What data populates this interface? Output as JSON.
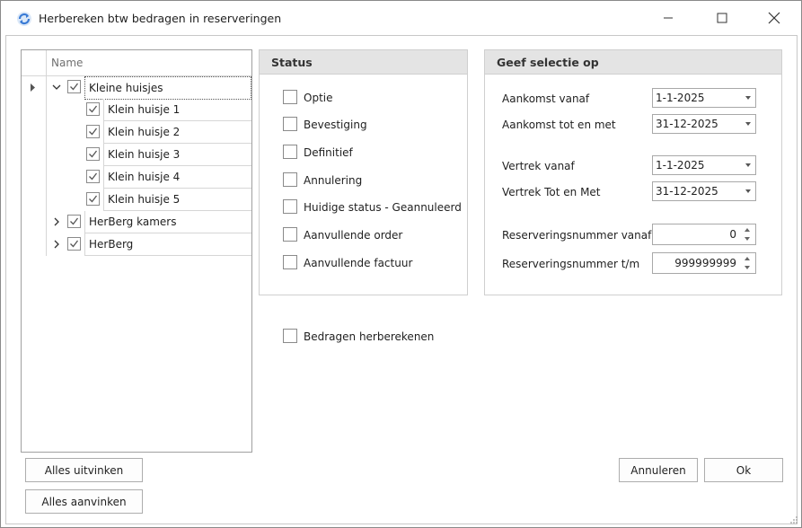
{
  "window": {
    "title": "Herbereken btw bedragen in reserveringen"
  },
  "tree": {
    "header": "Name",
    "rows": [
      {
        "label": "Kleine huisjes",
        "checked": true,
        "expanded": true
      },
      {
        "label": "Klein huisje 1",
        "checked": true
      },
      {
        "label": "Klein huisje 2",
        "checked": true
      },
      {
        "label": "Klein huisje 3",
        "checked": true
      },
      {
        "label": "Klein huisje 4",
        "checked": true
      },
      {
        "label": "Klein huisje 5",
        "checked": true
      },
      {
        "label": "HerBerg kamers",
        "checked": true,
        "expanded": false
      },
      {
        "label": "HerBerg",
        "checked": true,
        "expanded": false
      }
    ]
  },
  "status": {
    "title": "Status",
    "options": [
      "Optie",
      "Bevestiging",
      "Definitief",
      "Annulering",
      "Huidige status - Geannuleerd",
      "Aanvullende order",
      "Aanvullende factuur"
    ]
  },
  "selection": {
    "title": "Geef selectie op",
    "arrival_from_label": "Aankomst vanaf",
    "arrival_from": "1-1-2025",
    "arrival_to_label": "Aankomst tot en met",
    "arrival_to": "31-12-2025",
    "departure_from_label": "Vertrek vanaf",
    "departure_from": "1-1-2025",
    "departure_to_label": "Vertrek Tot en Met",
    "departure_to": "31-12-2025",
    "resnr_from_label": "Reserveringsnummer vanaf",
    "resnr_from": "0",
    "resnr_to_label": "Reserveringsnummer t/m",
    "resnr_to": "999999999"
  },
  "recalc": {
    "label": "Bedragen herberekenen"
  },
  "buttons": {
    "uncheck_all": "Alles uitvinken",
    "check_all": "Alles aanvinken",
    "cancel": "Annuleren",
    "ok": "Ok"
  },
  "colors": {
    "accent": "#3a7bd5",
    "group_header": "#e4e4e4",
    "border": "#a0a0a0"
  }
}
